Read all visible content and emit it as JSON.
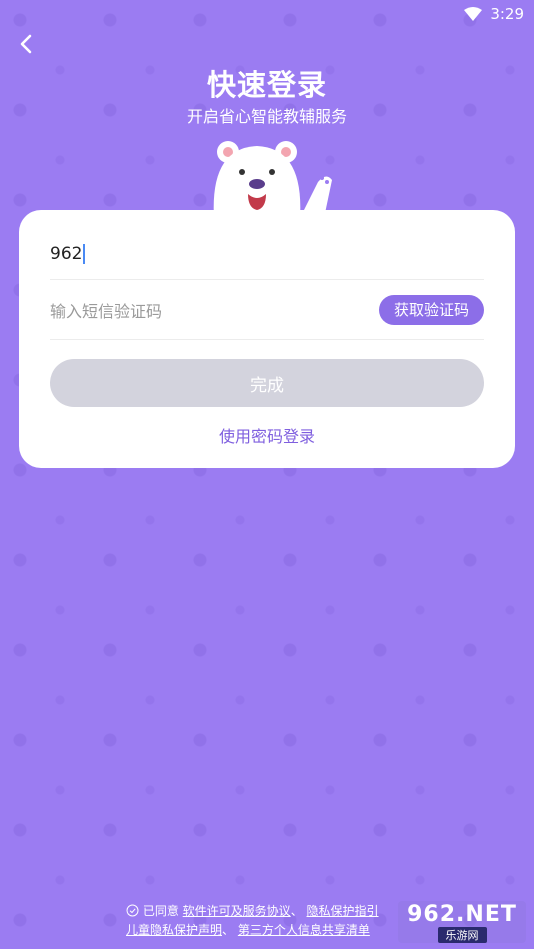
{
  "status_bar": {
    "time": "3:29"
  },
  "header": {
    "title": "快速登录",
    "subtitle": "开启省心智能教辅服务"
  },
  "form": {
    "phone_value": "962",
    "code_placeholder": "输入短信验证码",
    "get_code_label": "获取验证码",
    "done_label": "完成",
    "password_login_label": "使用密码登录"
  },
  "footer": {
    "agree_text": "已同意",
    "link_license": "软件许可及服务协议",
    "link_privacy_guide": "隐私保护指引",
    "link_child_privacy": "儿童隐私保护声明",
    "link_third_party": "第三方个人信息共享清单"
  },
  "watermark": {
    "top": "962.NET",
    "bottom": "乐游网"
  },
  "colors": {
    "background": "#9b7cf2",
    "accent": "#8c6ee8",
    "disabled_button": "#d3d3dd"
  }
}
